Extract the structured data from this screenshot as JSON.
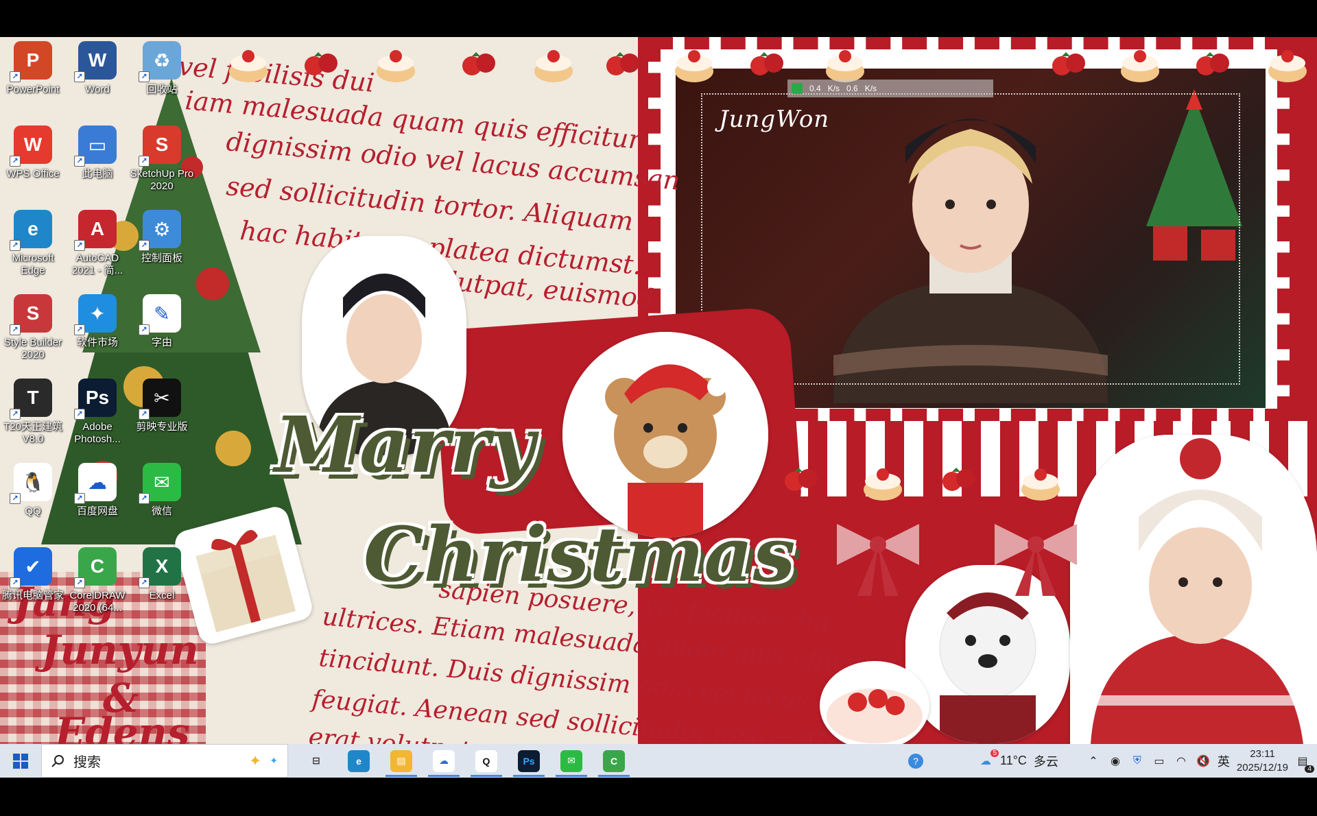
{
  "desktop": {
    "icons": [
      {
        "label": "PowerPoint",
        "glyph": "P",
        "color": "#d24726"
      },
      {
        "label": "Word",
        "glyph": "W",
        "color": "#2b579a"
      },
      {
        "label": "回收站",
        "glyph": "♻",
        "color": "#6aa6d8"
      },
      {
        "label": "WPS Office",
        "glyph": "W",
        "color": "#e63a2e"
      },
      {
        "label": "此电脑",
        "glyph": "▭",
        "color": "#3a7bd5"
      },
      {
        "label": "SketchUp Pro 2020",
        "glyph": "S",
        "color": "#d83b2c"
      },
      {
        "label": "Microsoft Edge",
        "glyph": "e",
        "color": "#1f86c9"
      },
      {
        "label": "AutoCAD 2021 - 简...",
        "glyph": "A",
        "color": "#c6262e"
      },
      {
        "label": "控制面板",
        "glyph": "⚙",
        "color": "#3d8bd8"
      },
      {
        "label": "Style Builder 2020",
        "glyph": "S",
        "color": "#c8383b"
      },
      {
        "label": "软件市场",
        "glyph": "✦",
        "color": "#1f8ee0"
      },
      {
        "label": "字由",
        "glyph": "✎",
        "color": "#ffffff"
      },
      {
        "label": "T20天正建筑 V8.0",
        "glyph": "T",
        "color": "#2a2a2a"
      },
      {
        "label": "Adobe Photosh...",
        "glyph": "Ps",
        "color": "#0c1c33"
      },
      {
        "label": "剪映专业版",
        "glyph": "✂",
        "color": "#111111"
      },
      {
        "label": "QQ",
        "glyph": "🐧",
        "color": "#ffffff"
      },
      {
        "label": "百度网盘",
        "glyph": "☁",
        "color": "#ffffff"
      },
      {
        "label": "微信",
        "glyph": "✉",
        "color": "#2bbb45"
      },
      {
        "label": "腾讯电脑管家",
        "glyph": "✔",
        "color": "#1f6be0"
      },
      {
        "label": "CorelDRAW 2020 (64...",
        "glyph": "C",
        "color": "#3aa64a"
      },
      {
        "label": "Excel",
        "glyph": "X",
        "color": "#217346"
      }
    ],
    "signature": "JungWon",
    "merry": "Marry",
    "christmas": "Christmas",
    "lorem_top": [
      "vel facilisis dui",
      "iam malesuada quam quis efficitur",
      "dignissim odio vel lacus accumsan",
      "sed sollicitudin tortor. Aliquam",
      "hac habitasse platea dictumst.",
      "volutpat, euismod"
    ],
    "lorem_bottom": [
      "sapien posuere, vel facilisis dui",
      "ultrices. Etiam malesuada quam quis efficitur",
      "tincidunt. Duis dignissim odio vel lacus accumsa",
      "feugiat. Aenean sed sollicitudin tortor. Aliq",
      "erat volutpat"
    ],
    "plaid_text": [
      "Jang",
      "Junyun",
      "&",
      "Edens"
    ],
    "net": {
      "down": "0.4",
      "up": "0.6",
      "unit": "K/s"
    }
  },
  "taskbar": {
    "search_placeholder": "搜索",
    "apps": [
      {
        "name": "task-view",
        "glyph": "⊟",
        "color": "#dfe5ee",
        "text": "#333",
        "active": false
      },
      {
        "name": "edge",
        "glyph": "e",
        "color": "#1f86c9",
        "text": "#fff",
        "active": false
      },
      {
        "name": "file-explorer",
        "glyph": "▤",
        "color": "#f2b632",
        "text": "#fff",
        "active": true
      },
      {
        "name": "baidu-netdisk",
        "glyph": "☁",
        "color": "#ffffff",
        "text": "#2a6fdb",
        "active": true
      },
      {
        "name": "qq",
        "glyph": "Q",
        "color": "#ffffff",
        "text": "#111",
        "active": true
      },
      {
        "name": "photoshop",
        "glyph": "Ps",
        "color": "#0c1c33",
        "text": "#31a8ff",
        "active": true
      },
      {
        "name": "wechat",
        "glyph": "✉",
        "color": "#2bbb45",
        "text": "#fff",
        "active": true
      },
      {
        "name": "coreldraw",
        "glyph": "C",
        "color": "#3aa64a",
        "text": "#fff",
        "active": true
      }
    ],
    "weather_temp": "11°C",
    "weather_desc": "多云",
    "weather_badge": "5",
    "ime": "英",
    "time": "23:11",
    "date": "2025/12/19",
    "notif_count": "4"
  }
}
